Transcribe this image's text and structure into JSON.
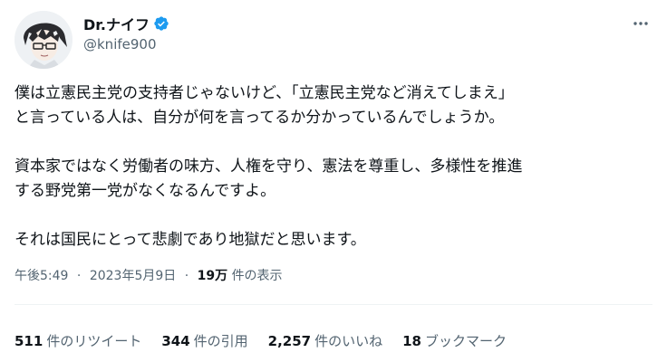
{
  "author": {
    "display_name": "Dr.ナイフ",
    "handle": "@knife900",
    "verified": true,
    "verified_color": "#1d9bf0"
  },
  "tweet": {
    "lines": [
      "僕は立憲民主党の支持者じゃないけど、「立憲民主党など消えてしまえ」",
      "と言っている人は、自分が何を言ってるか分かっているんでしょうか。",
      "資本家ではなく労働者の味方、人権を守り、憲法を尊重し、多様性を推進",
      "する野党第一党がなくなるんですよ。",
      "それは国民にとって悲劇であり地獄だと思います。"
    ]
  },
  "meta": {
    "time": "午後5:49",
    "separator": "·",
    "date": "2023年5月9日",
    "views_count": "19万",
    "views_label": "件の表示"
  },
  "stats": {
    "retweets": {
      "count": "511",
      "label": "件のリツイート"
    },
    "quotes": {
      "count": "344",
      "label": "件の引用"
    },
    "likes": {
      "count": "2,257",
      "label": "件のいいね"
    },
    "bookmarks": {
      "count": "18",
      "label": "ブックマーク"
    }
  },
  "icons": {
    "more": "more-icon",
    "verified": "verified-badge-icon"
  }
}
